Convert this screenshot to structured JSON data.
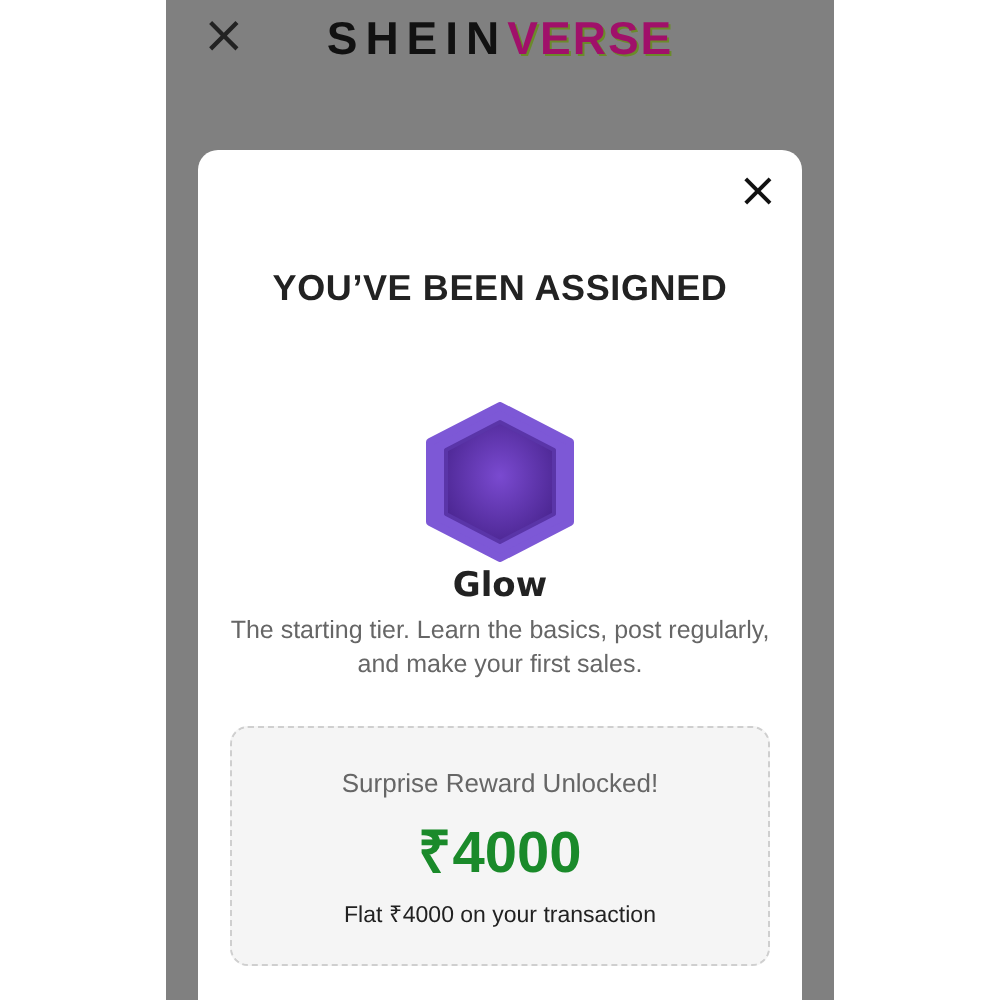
{
  "header": {
    "close_icon": "×",
    "logo": {
      "first": "SHEIN",
      "second": "VERSE"
    }
  },
  "dialog": {
    "close_icon": "×",
    "title": "YOU’VE BEEN ASSIGNED",
    "tier": {
      "name": "Glow",
      "description": "The starting tier. Learn the basics, post regularly, and make your first sales."
    },
    "reward": {
      "heading": "Surprise Reward Unlocked!",
      "amount": "₹4000",
      "note": "Flat ₹4000 on your transaction"
    }
  }
}
